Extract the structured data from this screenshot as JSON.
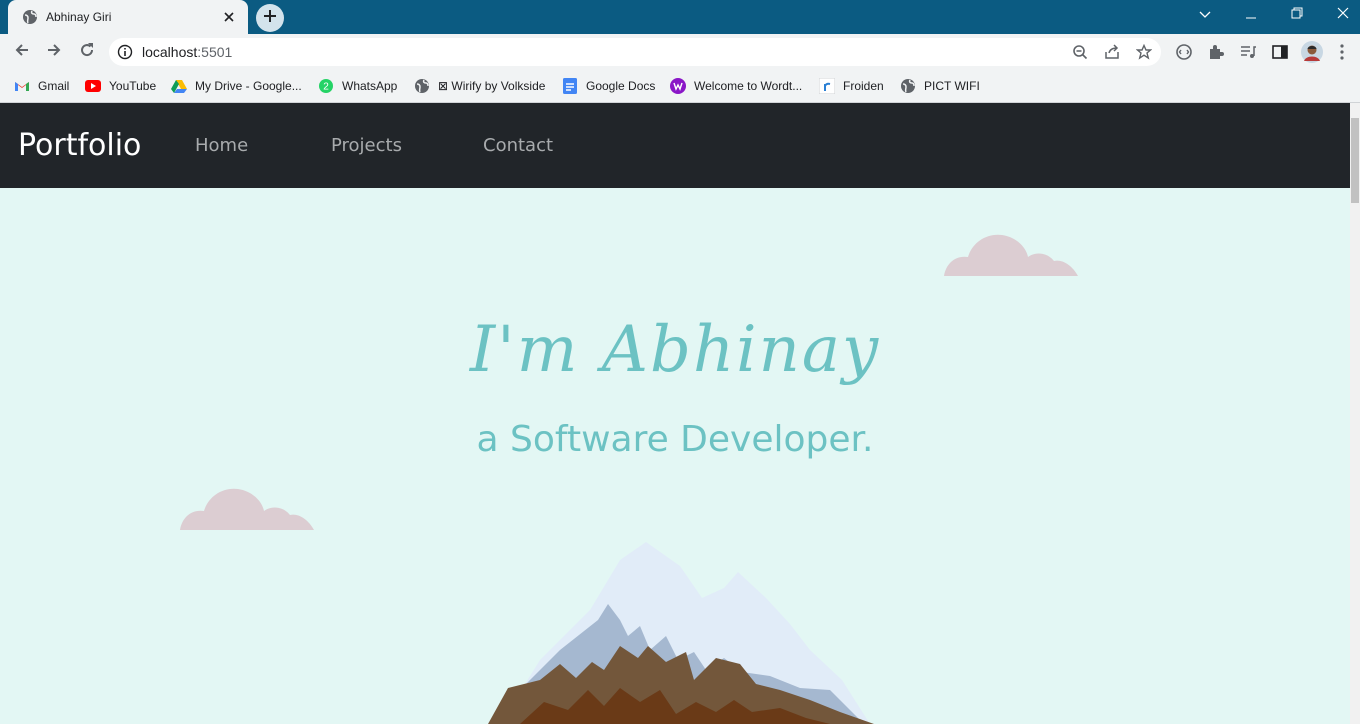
{
  "browser": {
    "tab": {
      "title": "Abhinay Giri",
      "favicon": "globe-icon",
      "close_icon": "close-icon"
    },
    "new_tab_icon": "plus-icon",
    "window_controls": [
      "chevron-down-icon",
      "minimize-icon",
      "restore-icon",
      "close-icon"
    ],
    "address": {
      "host": "localhost",
      "port": ":5501"
    },
    "omnibox_icons": [
      "zoom-icon",
      "share-icon",
      "star-icon"
    ],
    "toolbar_icons": [
      "extension-icon",
      "puzzle-icon",
      "media-icon",
      "side-panel-icon",
      "avatar",
      "more-icon"
    ],
    "bookmarks": [
      {
        "label": "Gmail",
        "icon": "gmail-icon"
      },
      {
        "label": "YouTube",
        "icon": "youtube-icon"
      },
      {
        "label": "My Drive - Google...",
        "icon": "drive-icon"
      },
      {
        "label": "WhatsApp",
        "icon": "whatsapp-icon",
        "badge": "2"
      },
      {
        "label": "⊠ Wirify by Volkside",
        "icon": "globe-icon"
      },
      {
        "label": "Google Docs",
        "icon": "docs-icon"
      },
      {
        "label": "Welcome to Wordt...",
        "icon": "wordtune-icon"
      },
      {
        "label": "Froiden",
        "icon": "froiden-icon"
      },
      {
        "label": "PICT WIFI",
        "icon": "globe-icon"
      }
    ]
  },
  "site": {
    "brand": "Portfolio",
    "nav": [
      "Home",
      "Projects",
      "Contact"
    ],
    "hero": {
      "name": "I'm Abhinay",
      "tagline": "a Software Developer."
    },
    "colors": {
      "accent": "#6cc2c3",
      "navbar": "#212529",
      "background": "#e3f7f4",
      "cloud": "#dccdd2"
    }
  }
}
